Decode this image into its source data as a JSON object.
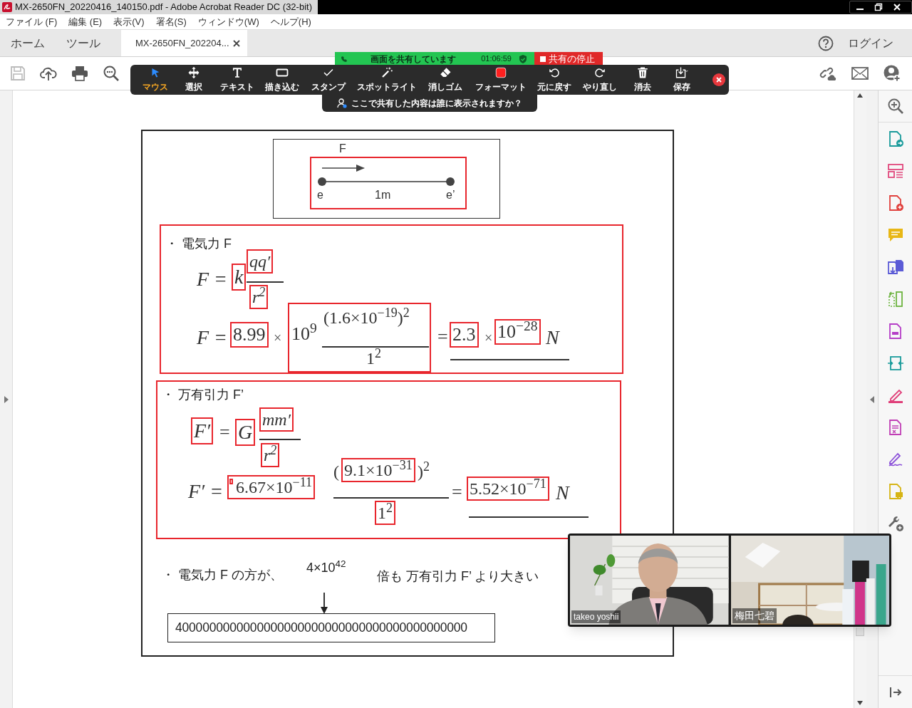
{
  "window": {
    "title": "MX-2650FN_20220416_140150.pdf - Adobe Acrobat Reader DC (32-bit)"
  },
  "menu": [
    "ファイル (F)",
    "編集 (E)",
    "表示(V)",
    "署名(S)",
    "ウィンドウ(W)",
    "ヘルプ(H)"
  ],
  "tabs": [
    {
      "label": "ホーム",
      "selected": false,
      "closable": false
    },
    {
      "label": "ツール",
      "selected": false,
      "closable": false
    },
    {
      "label": "MX-2650FN_202204...",
      "selected": true,
      "closable": true
    }
  ],
  "login": "ログイン",
  "share_bar": {
    "status": "画面を共有しています",
    "timer": "01:06:59",
    "stop_button": "共有の停止"
  },
  "annotation_tools": [
    {
      "kind": "pointer",
      "label": "マウス",
      "selected": true
    },
    {
      "kind": "move",
      "label": "選択",
      "selected": false
    },
    {
      "kind": "text",
      "label": "テキスト",
      "selected": false
    },
    {
      "kind": "draw",
      "label": "描き込む",
      "selected": false
    },
    {
      "kind": "stamp",
      "label": "スタンプ",
      "selected": false
    },
    {
      "kind": "spotlight",
      "label": "スポットライト",
      "selected": false
    },
    {
      "kind": "eraser",
      "label": "消しゴム",
      "selected": false
    },
    {
      "kind": "format",
      "label": "フォーマット",
      "selected": false
    },
    {
      "kind": "undo",
      "label": "元に戻す",
      "selected": false
    },
    {
      "kind": "redo",
      "label": "やり直し",
      "selected": false
    },
    {
      "kind": "clear",
      "label": "消去",
      "selected": false
    },
    {
      "kind": "save",
      "label": "保存",
      "selected": false
    }
  ],
  "tooltip": "ここで共有した内容は誰に表示されますか？",
  "document": {
    "diagram_labels": [
      "F",
      "e",
      "1m",
      "e’"
    ],
    "electric_force": [
      "・ 電気力 F",
      "F =",
      "k",
      "qq′",
      "r$^{2}$",
      "F =",
      "8.99",
      "×",
      "10$^{9}$",
      "(1.6×10$^{−19}$)$^{2}$",
      "1$^{2}$",
      "=",
      "2.3",
      "×",
      "10$^{−28}$",
      "N"
    ],
    "gravitation": [
      "・ 万有引力 F’",
      "F′",
      "=",
      "G",
      "mm′",
      "r$^{2}$",
      "F′ =",
      "6.67×10$^{−11}$",
      "(",
      "9.1×10$^{−31}$",
      ")$^{2}$",
      "1$^{2}$",
      "=",
      "5.52×10$^{−71}$",
      "N"
    ],
    "comparison": [
      "・ 電気力 F の方が、",
      "4×10$^{42}$",
      "倍も 万有引力 F’ より大きい"
    ],
    "full_number": "4000000000000000000000000000000000000000000"
  },
  "participants": [
    {
      "name": "takeo yoshii"
    },
    {
      "name": "梅田七碧"
    }
  ]
}
